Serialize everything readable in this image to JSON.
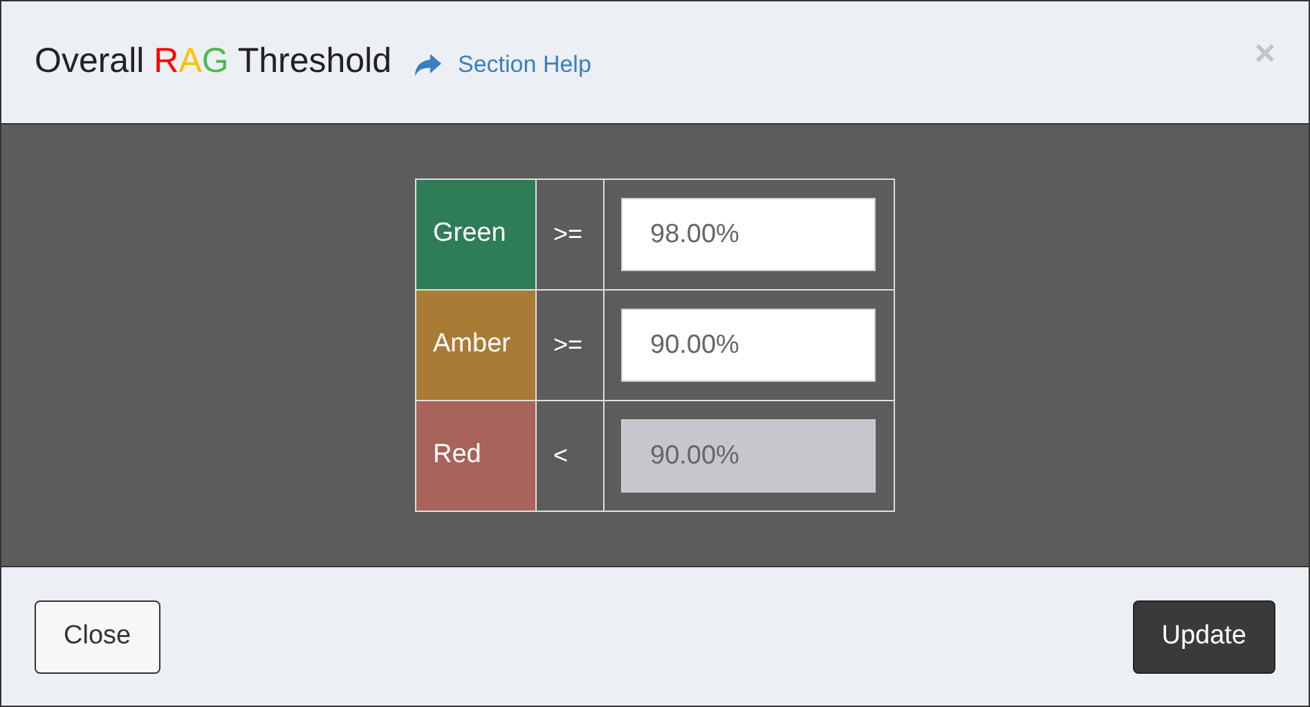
{
  "dialog": {
    "title_parts": [
      {
        "text": "Overall ",
        "color": "#222222"
      },
      {
        "text": "R",
        "color": "#ff0000"
      },
      {
        "text": "A",
        "color": "#ffc000"
      },
      {
        "text": "G",
        "color": "#4cbb4c"
      },
      {
        "text": " Threshold",
        "color": "#222222"
      }
    ],
    "help_link": "Section Help",
    "close_glyph": "×"
  },
  "thresholds": [
    {
      "label": "Green",
      "color": "#2e7d59",
      "operator": ">=",
      "value": "98.00%",
      "disabled": false
    },
    {
      "label": "Amber",
      "color": "#a87c35",
      "operator": ">=",
      "value": "90.00%",
      "disabled": false
    },
    {
      "label": "Red",
      "color": "#a8635a",
      "operator": "<",
      "value": "90.00%",
      "disabled": true
    }
  ],
  "buttons": [
    {
      "label": "Close",
      "kind": "secondary"
    },
    {
      "label": "Update",
      "kind": "primary"
    }
  ]
}
